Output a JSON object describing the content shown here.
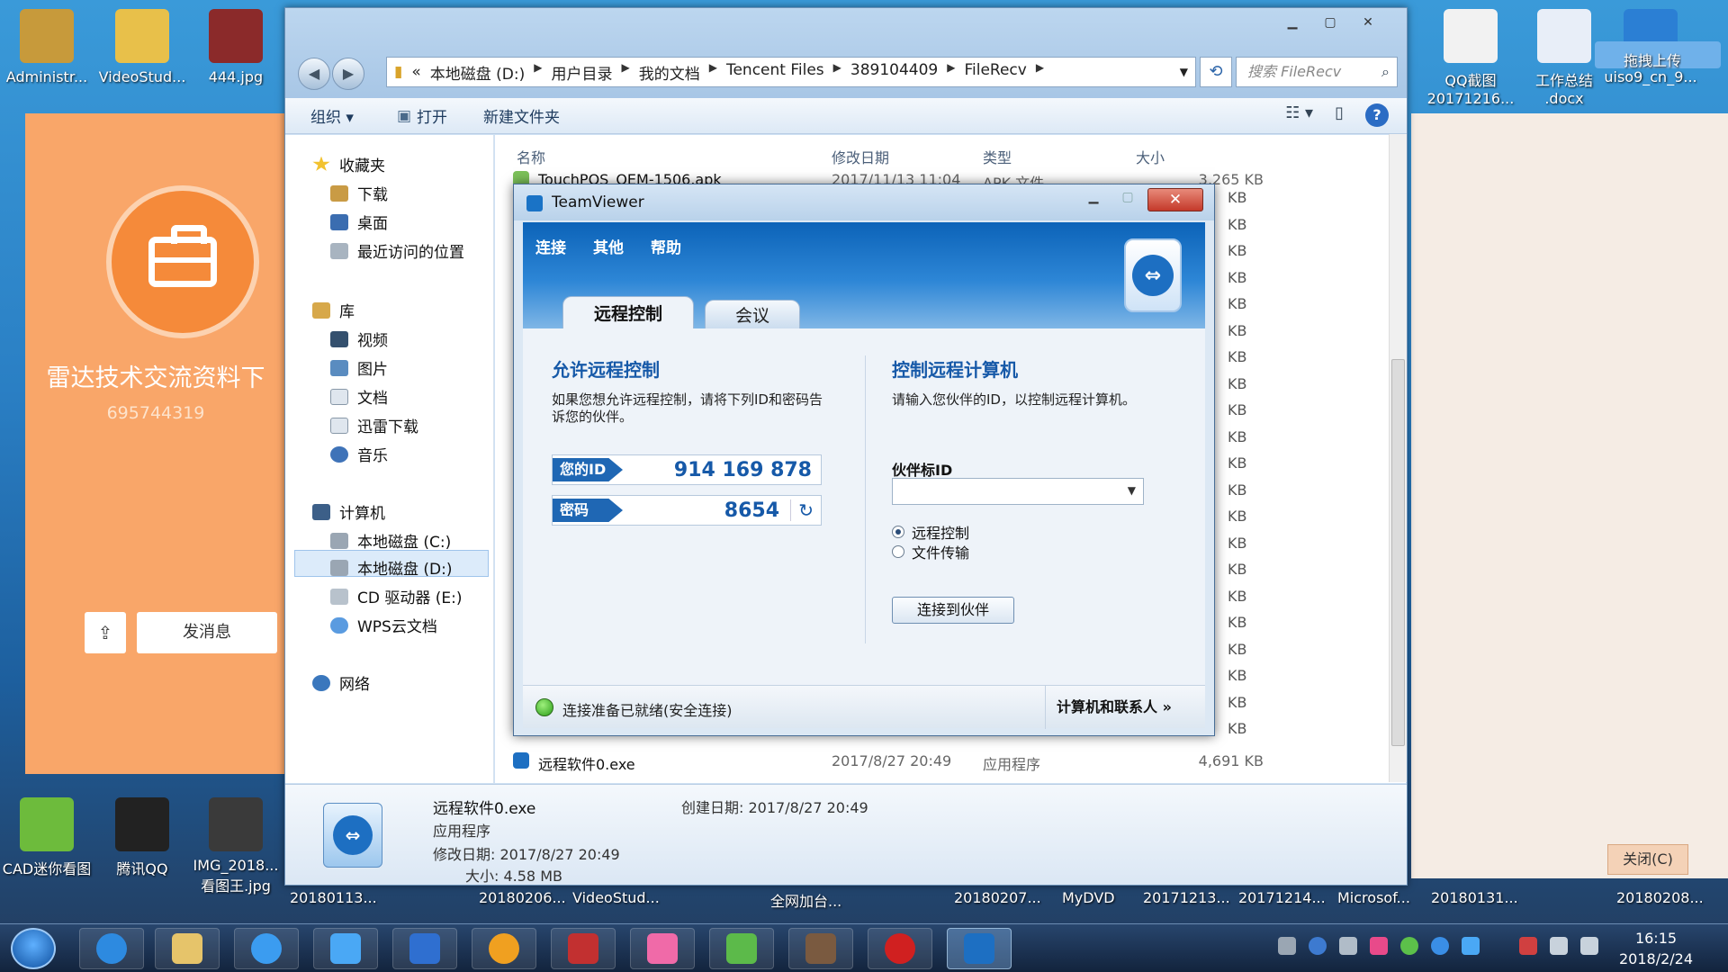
{
  "desktop": {
    "icons_top": [
      {
        "label": "Administr...",
        "color": "#c79a3b"
      },
      {
        "label": "VideoStud...",
        "color": "#e8c04a"
      },
      {
        "label": "444.jpg",
        "color": "#8b2a2a"
      }
    ],
    "icons_top_right": [
      {
        "label": "QQ截图\n20171216...",
        "color": "#f2f2f2"
      },
      {
        "label": "工作总结\n.docx",
        "color": "#e8eef8"
      },
      {
        "label": "uiso9_cn_9...",
        "color": "#2b7fd4"
      }
    ],
    "icons_bottom": [
      {
        "label": "CAD迷你看图",
        "color": "#6dbb3c"
      },
      {
        "label": "腾讯QQ",
        "color": "#222222"
      },
      {
        "label": "IMG_2018...\n看图王.jpg",
        "color": "#3a3a3a"
      }
    ],
    "drag_upload_label": "拖拽上传",
    "bottom_row_labels": [
      "20180113...",
      "20180206...",
      "VideoStud...",
      "全网加台...",
      "20180207...",
      "MyDVD",
      "20171213...",
      "20171214...",
      "Microsof...",
      "20180131...",
      "20180208..."
    ]
  },
  "qq_group": {
    "name": "雷达技术交流资料下",
    "number": "695744319",
    "send_message": "发消息",
    "share_icon": "share-icon"
  },
  "right_window": {
    "close_label": "关闭(C)"
  },
  "explorer": {
    "address": {
      "prefix": "«",
      "crumbs": [
        "本地磁盘 (D:)",
        "用户目录",
        "我的文档",
        "Tencent Files",
        "389104409",
        "FileRecv"
      ]
    },
    "search_placeholder": "搜索 FileRecv",
    "toolbar": {
      "organize": "组织 ▾",
      "open": "打开",
      "new_folder": "新建文件夹"
    },
    "nav": {
      "favorites": "收藏夹",
      "downloads": "下载",
      "desktop": "桌面",
      "recent": "最近访问的位置",
      "libraries": "库",
      "videos": "视频",
      "pictures": "图片",
      "documents": "文档",
      "xunlei": "迅雷下载",
      "music": "音乐",
      "computer": "计算机",
      "drive_c": "本地磁盘 (C:)",
      "drive_d": "本地磁盘 (D:)",
      "drive_e": "CD 驱动器 (E:)",
      "wps": "WPS云文档",
      "network": "网络"
    },
    "columns": {
      "name": "名称",
      "date": "修改日期",
      "type": "类型",
      "size": "大小"
    },
    "files": [
      {
        "name": "TouchPOS_OEM-1506.apk",
        "date": "2017/11/13 11:04",
        "type": "APK 文件",
        "size": "3,265 KB"
      },
      {
        "name": "远程软件0.exe",
        "date": "2017/8/27 20:49",
        "type": "应用程序",
        "size": "4,691 KB"
      }
    ],
    "kb_unit": "KB",
    "details": {
      "name": "远程软件0.exe",
      "type": "应用程序",
      "modified": "修改日期: 2017/8/27 20:49",
      "size": "大小: 4.58 MB",
      "created": "创建日期: 2017/8/27 20:49"
    }
  },
  "teamviewer": {
    "title": "TeamViewer",
    "menu": {
      "connect": "连接",
      "extras": "其他",
      "help": "帮助"
    },
    "tabs": {
      "remote_control": "远程控制",
      "meeting": "会议"
    },
    "allow": {
      "heading": "允许远程控制",
      "desc": "如果您想允许远程控制，请将下列ID和密码告诉您的伙伴。",
      "id_label": "您的ID",
      "id_value": "914 169 878",
      "pw_label": "密码",
      "pw_value": "8654"
    },
    "control": {
      "heading": "控制远程计算机",
      "desc": "请输入您伙伴的ID，以控制远程计算机。",
      "partner_label": "伙伴标ID",
      "partner_value": "",
      "radio_remote": "远程控制",
      "radio_file": "文件传输",
      "selected": "remote",
      "connect_button": "连接到伙伴"
    },
    "status": "连接准备已就绪(安全连接)",
    "contacts": "计算机和联系人 »"
  },
  "taskbar": {
    "time": "16:15",
    "date": "2018/2/24"
  }
}
